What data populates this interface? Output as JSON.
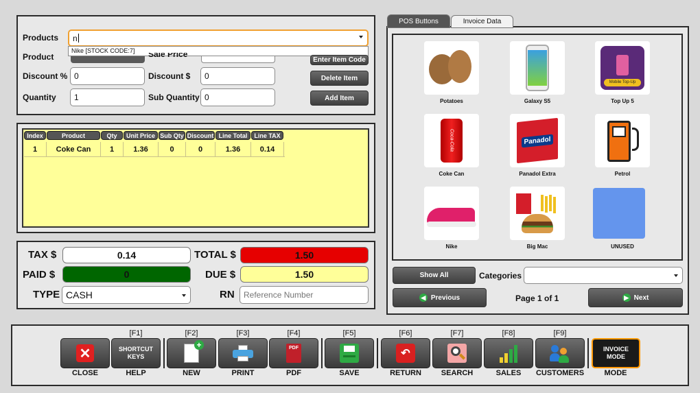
{
  "product_form": {
    "products_label": "Products",
    "products_value": "n",
    "suggestion": "Nike [STOCK CODE:7]",
    "product_label": "Product",
    "sale_price_label": "Sale Price",
    "discount_pct_label": "Discount %",
    "discount_pct_value": "0",
    "discount_amt_label": "Discount $",
    "discount_amt_value": "0",
    "quantity_label": "Quantity",
    "quantity_value": "1",
    "sub_quantity_label": "Sub Quantity",
    "sub_quantity_value": "0",
    "enter_code_button": "Enter Item Code",
    "delete_item_button": "Delete Item",
    "add_item_button": "Add Item"
  },
  "table": {
    "headers": [
      "Index",
      "Product",
      "Qty",
      "Unit Price",
      "Sub Qty",
      "Discount",
      "Line Total",
      "Line TAX"
    ],
    "rows": [
      [
        "1",
        "Coke Can",
        "1",
        "1.36",
        "0",
        "0",
        "1.36",
        "0.14"
      ]
    ]
  },
  "totals": {
    "tax_label": "TAX $",
    "tax_value": "0.14",
    "total_label": "TOTAL $",
    "total_value": "1.50",
    "paid_label": "PAID $",
    "paid_value": "0",
    "due_label": "DUE $",
    "due_value": "1.50",
    "type_label": "TYPE",
    "type_value": "CASH",
    "rn_label": "RN",
    "rn_placeholder": "Reference Number"
  },
  "tabs": [
    "POS Buttons",
    "Invoice Data"
  ],
  "pos_items": [
    {
      "name": "Potatoes",
      "icon": "potatoes-icon"
    },
    {
      "name": "Galaxy S5",
      "icon": "smartphone-icon"
    },
    {
      "name": "Top Up 5",
      "icon": "mobile-topup-icon"
    },
    {
      "name": "Coke Can",
      "icon": "cola-can-icon"
    },
    {
      "name": "Panadol Extra",
      "icon": "medicine-box-icon"
    },
    {
      "name": "Petrol",
      "icon": "fuel-pump-icon"
    },
    {
      "name": "Nike",
      "icon": "sneaker-icon"
    },
    {
      "name": "Big Mac",
      "icon": "burger-meal-icon"
    },
    {
      "name": "UNUSED",
      "icon": "blank-tile-icon"
    }
  ],
  "pos_nav": {
    "show_all": "Show All",
    "categories_label": "Categories",
    "previous": "Previous",
    "page_text": "Page 1 of 1",
    "next": "Next"
  },
  "toolbar": {
    "close": {
      "key": "",
      "caption": "CLOSE"
    },
    "help": {
      "key": "[F1]",
      "face": "SHORTCUT KEYS",
      "caption": "HELP"
    },
    "new": {
      "key": "[F2]",
      "caption": "NEW"
    },
    "print": {
      "key": "[F3]",
      "caption": "PRINT"
    },
    "pdf": {
      "key": "[F4]",
      "caption": "PDF"
    },
    "save": {
      "key": "[F5]",
      "caption": "SAVE"
    },
    "return": {
      "key": "[F6]",
      "caption": "RETURN"
    },
    "search": {
      "key": "[F7]",
      "caption": "SEARCH"
    },
    "sales": {
      "key": "[F8]",
      "caption": "SALES"
    },
    "customers": {
      "key": "[F9]",
      "caption": "CUSTOMERS"
    },
    "mode": {
      "key": "",
      "face": "INVOICE MODE",
      "caption": "MODE"
    }
  },
  "colors": {
    "total_bg": "#e60000",
    "paid_bg": "#006600",
    "due_bg": "#ffff99",
    "grid_bg": "#ffff99",
    "unused_tile": "#6495ed",
    "mode_border": "#ff9900"
  }
}
